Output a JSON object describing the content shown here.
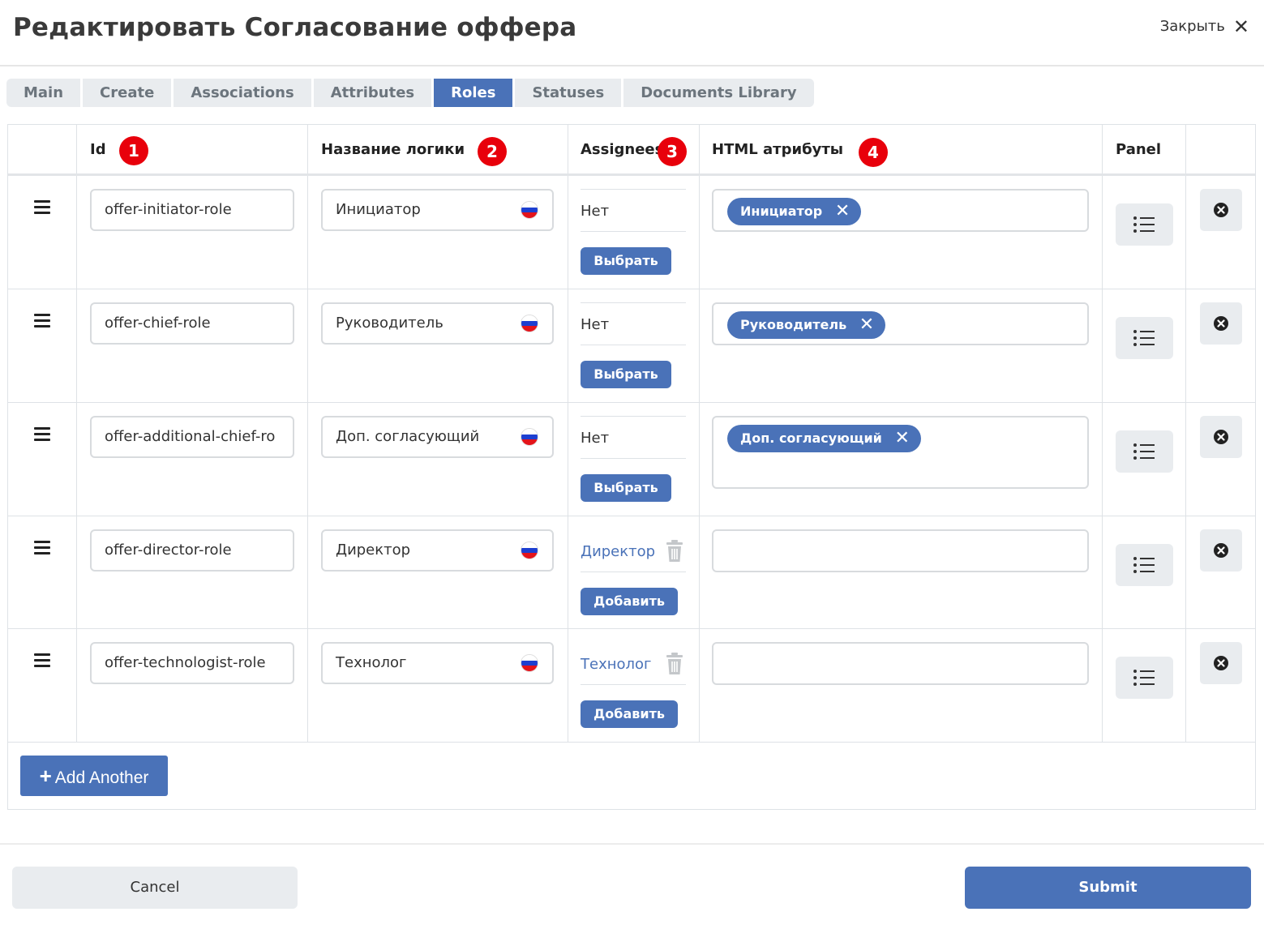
{
  "header": {
    "title": "Редактировать Согласование оффера",
    "close_label": "Закрыть"
  },
  "tabs": [
    {
      "label": "Main",
      "active": false
    },
    {
      "label": "Create",
      "active": false
    },
    {
      "label": "Associations",
      "active": false
    },
    {
      "label": "Attributes",
      "active": false
    },
    {
      "label": "Roles",
      "active": true
    },
    {
      "label": "Statuses",
      "active": false
    },
    {
      "label": "Documents Library",
      "active": false
    }
  ],
  "columns": {
    "id": "Id",
    "name": "Название логики",
    "assignees": "Assignees",
    "html": "HTML атрибуты",
    "panel": "Panel"
  },
  "badges": [
    "1",
    "2",
    "3",
    "4"
  ],
  "rows": [
    {
      "id": "offer-initiator-role",
      "name": "Инициатор",
      "assignee": "Нет",
      "assignee_is_link": false,
      "action": "Выбрать",
      "tag": "Инициатор"
    },
    {
      "id": "offer-chief-role",
      "name": "Руководитель",
      "assignee": "Нет",
      "assignee_is_link": false,
      "action": "Выбрать",
      "tag": "Руководитель"
    },
    {
      "id": "offer-additional-chief-ro",
      "name": "Доп. согласующий",
      "assignee": "Нет",
      "assignee_is_link": false,
      "action": "Выбрать",
      "tag": "Доп. согласующий"
    },
    {
      "id": "offer-director-role",
      "name": "Директор",
      "assignee": "Директор",
      "assignee_is_link": true,
      "action": "Добавить",
      "tag": ""
    },
    {
      "id": "offer-technologist-role",
      "name": "Технолог",
      "assignee": "Технолог",
      "assignee_is_link": true,
      "action": "Добавить",
      "tag": ""
    }
  ],
  "add_another_label": "Add Another",
  "footer": {
    "cancel_label": "Cancel",
    "submit_label": "Submit"
  },
  "icons": {
    "drag": "drag-handle-icon",
    "flag": "russia-flag-icon",
    "trash": "trash-icon",
    "panel": "list-icon",
    "remove": "close-circle-icon",
    "tag_remove": "close-icon"
  },
  "colors": {
    "accent": "#4a72b8",
    "badge": "#e8000b",
    "tab_inactive": "#e9ecef",
    "link": "#4a72b8"
  }
}
